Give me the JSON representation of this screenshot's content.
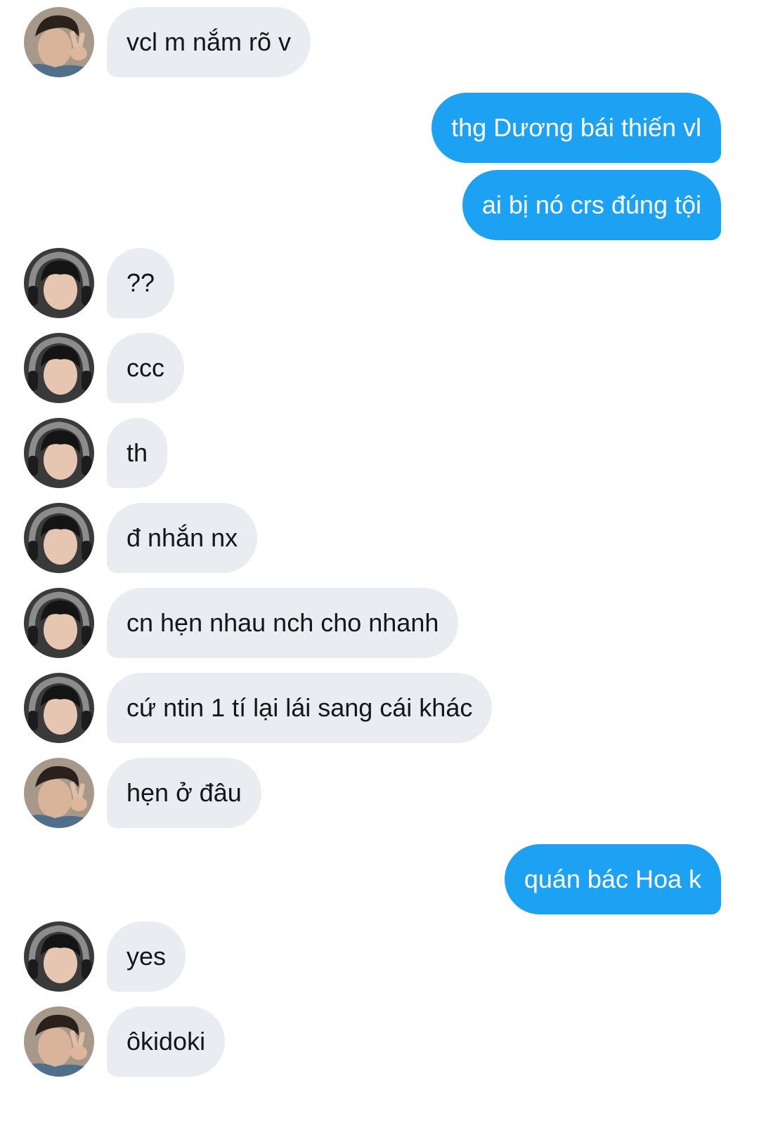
{
  "colors": {
    "incoming_bubble": "#e9edf1",
    "outgoing_bubble": "#1da1f2",
    "incoming_text": "#14171a",
    "outgoing_text": "#ffffff",
    "background": "#ffffff"
  },
  "messages": [
    {
      "direction": "incoming",
      "sender_avatar": "avatar-peace-sign",
      "text": "vcl m nắm rõ v"
    },
    {
      "direction": "outgoing",
      "text": "thg Dương bái thiến vl"
    },
    {
      "direction": "outgoing",
      "text": "ai bị nó crs đúng tội"
    },
    {
      "direction": "incoming",
      "sender_avatar": "avatar-headphones",
      "text": "??"
    },
    {
      "direction": "incoming",
      "sender_avatar": "avatar-headphones",
      "text": "ccc"
    },
    {
      "direction": "incoming",
      "sender_avatar": "avatar-headphones",
      "text": "th"
    },
    {
      "direction": "incoming",
      "sender_avatar": "avatar-headphones",
      "text": "đ nhắn nx"
    },
    {
      "direction": "incoming",
      "sender_avatar": "avatar-headphones",
      "text": "cn hẹn nhau nch cho nhanh"
    },
    {
      "direction": "incoming",
      "sender_avatar": "avatar-headphones",
      "text": "cứ ntin 1 tí lại lái sang cái khác"
    },
    {
      "direction": "incoming",
      "sender_avatar": "avatar-peace-sign",
      "text": "hẹn ở đâu"
    },
    {
      "direction": "outgoing",
      "text": "quán bác Hoa k"
    },
    {
      "direction": "incoming",
      "sender_avatar": "avatar-headphones",
      "text": "yes"
    },
    {
      "direction": "incoming",
      "sender_avatar": "avatar-peace-sign",
      "text": "ôkidoki"
    }
  ]
}
